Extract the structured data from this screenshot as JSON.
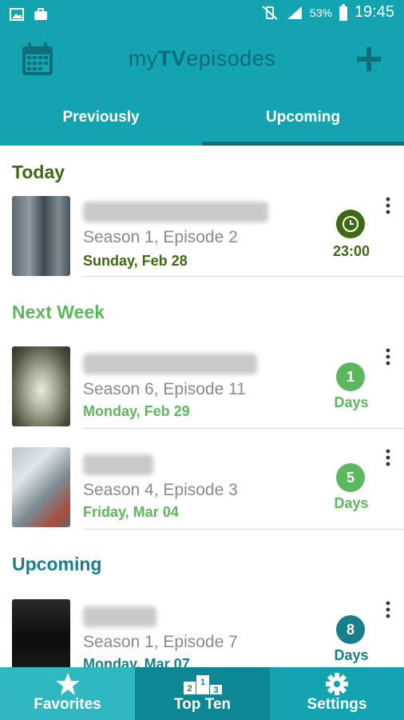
{
  "status_bar": {
    "battery": "53%",
    "time": "19:45"
  },
  "app_bar": {
    "title_prefix": "my",
    "title_bold": "TV",
    "title_suffix": "episodes"
  },
  "tabs": [
    {
      "label": "Previously",
      "selected": false
    },
    {
      "label": "Upcoming",
      "selected": true
    }
  ],
  "sections": [
    {
      "title": "Today",
      "color": "#3d6a12"
    },
    {
      "title": "Next Week",
      "color": "#5cb85c"
    },
    {
      "title": "Upcoming",
      "color": "#17808c"
    }
  ],
  "episodes": [
    {
      "season": "Season 1, Episode 2",
      "date": "Sunday, Feb 28",
      "badge_label": "23:00",
      "badge_icon": "clock-icon",
      "color": "#3d6a12"
    },
    {
      "season": "Season 6, Episode 11",
      "date": "Monday, Feb 29",
      "badge_value": "1",
      "badge_label": "Days",
      "color": "#5cb85c"
    },
    {
      "season": "Season 4, Episode 3",
      "date": "Friday, Mar 04",
      "badge_value": "5",
      "badge_label": "Days",
      "color": "#5cb85c"
    },
    {
      "season": "Season 1, Episode 7",
      "date": "Monday, Mar 07",
      "badge_value": "8",
      "badge_label": "Days",
      "color": "#17808c"
    }
  ],
  "bottom_nav": [
    {
      "label": "Favorites",
      "icon": "star-icon",
      "selected": true
    },
    {
      "label": "Top Ten",
      "icon": "podium-icon",
      "selected": false
    },
    {
      "label": "Settings",
      "icon": "gear-icon",
      "selected": false
    }
  ],
  "colors": {
    "primary": "#14a3b0",
    "primary_dark": "#0d6f7a",
    "today": "#3d6a12",
    "next_week": "#5cb85c",
    "upcoming": "#17808c"
  }
}
